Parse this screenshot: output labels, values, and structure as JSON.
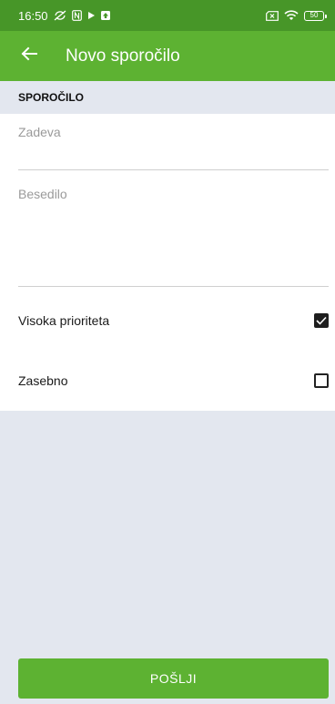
{
  "status_bar": {
    "time": "16:50",
    "battery": "50",
    "icons": [
      "sync-off-icon",
      "nfc-icon",
      "play-icon",
      "upload-icon",
      "sim-x-icon",
      "wifi-icon",
      "battery-icon"
    ]
  },
  "app_bar": {
    "title": "Novo sporočilo",
    "back_icon": "arrow-left-icon"
  },
  "section": {
    "title": "SPOROČILO"
  },
  "form": {
    "subject": {
      "placeholder": "Zadeva",
      "value": ""
    },
    "body": {
      "placeholder": "Besedilo",
      "value": ""
    },
    "high_priority": {
      "label": "Visoka prioriteta",
      "checked": true
    },
    "private": {
      "label": "Zasebno",
      "checked": false
    }
  },
  "send_button": {
    "label": "POŠLJI"
  },
  "colors": {
    "status_bar": "#479628",
    "app_bar": "#5db232",
    "button": "#5db232",
    "background": "#e3e7ef"
  }
}
